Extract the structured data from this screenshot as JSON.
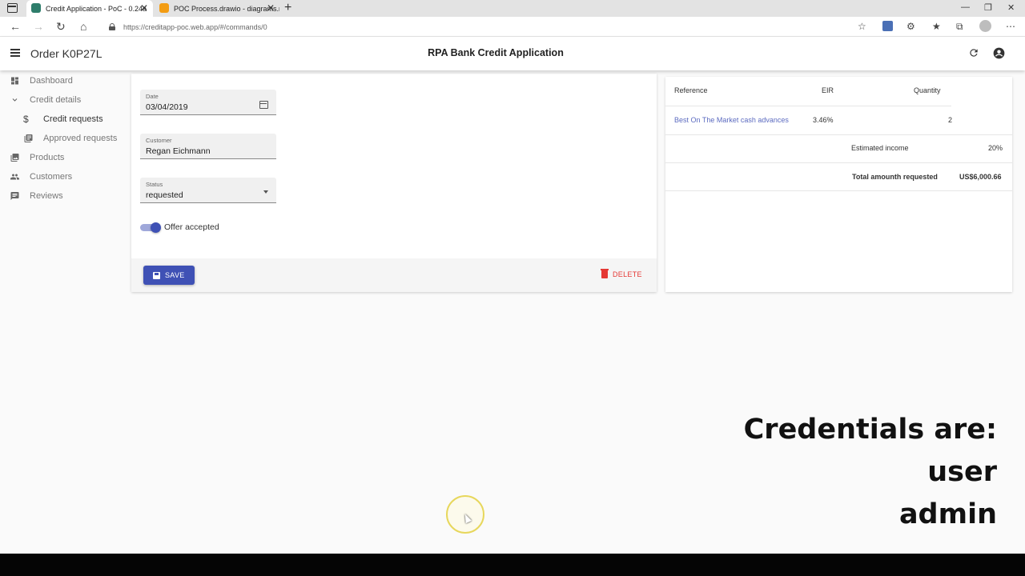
{
  "browser": {
    "tabs": [
      {
        "title": "Credit Application - PoC - 0.24a",
        "favicon_color": "#2e7d6b",
        "active": true
      },
      {
        "title": "POC Process.drawio - diagrams.n",
        "favicon_color": "#f39c12",
        "active": false
      }
    ],
    "url": "https://creditapp-poc.web.app/#/commands/0"
  },
  "header": {
    "order_title": "Order K0P27L",
    "app_title": "RPA Bank Credit Application"
  },
  "sidebar": {
    "items": [
      {
        "label": "Dashboard",
        "icon": "dashboard-icon"
      },
      {
        "label": "Credit details",
        "icon": "chevron-down-icon"
      },
      {
        "label": "Credit requests",
        "icon": "dollar-icon"
      },
      {
        "label": "Approved requests",
        "icon": "list-icon"
      },
      {
        "label": "Products",
        "icon": "image-icon"
      },
      {
        "label": "Customers",
        "icon": "people-icon"
      },
      {
        "label": "Reviews",
        "icon": "comment-icon"
      }
    ]
  },
  "form": {
    "date": {
      "label": "Date",
      "value": "03/04/2019"
    },
    "customer": {
      "label": "Customer",
      "value": "Regan Eichmann"
    },
    "status": {
      "label": "Status",
      "value": "requested"
    },
    "offer_accepted": {
      "label": "Offer accepted",
      "checked": true
    },
    "save_label": "SAVE",
    "delete_label": "DELETE"
  },
  "summary": {
    "headers": {
      "reference": "Reference",
      "eir": "EIR",
      "quantity": "Quantity"
    },
    "row": {
      "reference": "Best On The Market cash advances",
      "eir": "3.46%",
      "quantity": "2"
    },
    "estimated_income": {
      "label": "Estimated income",
      "value": "20%"
    },
    "total": {
      "label": "Total amounth requested",
      "value": "US$6,000.66"
    }
  },
  "overlay": {
    "line1": "Credentials are:",
    "line2": "user",
    "line3": "admin"
  },
  "colors": {
    "primary": "#3f51b5",
    "danger": "#e53935",
    "link": "#5c6bc0"
  }
}
